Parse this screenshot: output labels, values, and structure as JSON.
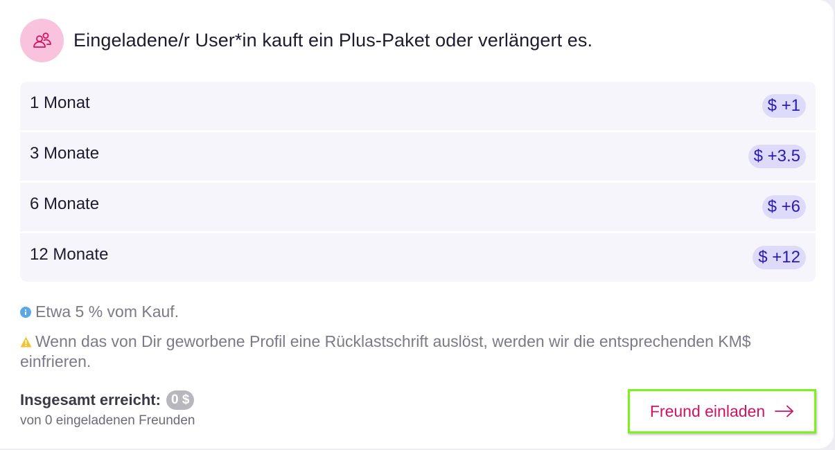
{
  "header": {
    "icon": "users-icon",
    "title": "Eingeladene/r User*in kauft ein Plus-Paket oder verlängert es."
  },
  "tiers": [
    {
      "label": "1 Monat",
      "reward": "$ +1"
    },
    {
      "label": "3 Monate",
      "reward": "$ +3.5"
    },
    {
      "label": "6 Monate",
      "reward": "$ +6"
    },
    {
      "label": "12 Monate",
      "reward": "$ +12"
    }
  ],
  "notes": {
    "info_icon": "info-icon",
    "info": "Etwa 5 % vom Kauf.",
    "warning_icon": "warning-icon",
    "warning": "Wenn das von Dir geworbene Profil eine Rücklastschrift auslöst, werden wir die entsprechenden KM$ einfrieren."
  },
  "total": {
    "label": "Insgesamt erreicht:",
    "value": "0 $",
    "subtitle": "von 0 eingeladenen Freunden"
  },
  "invite_button": {
    "label": "Freund einladen",
    "icon": "arrow-right-icon"
  },
  "colors": {
    "accent": "#d0135f",
    "icon_circle": "#f9c3dd",
    "badge_bg": "#dedaf9",
    "badge_text": "#2a1bb0",
    "highlight_border": "#7df218",
    "info": "#5aa9e6",
    "warning": "#f2c230"
  }
}
